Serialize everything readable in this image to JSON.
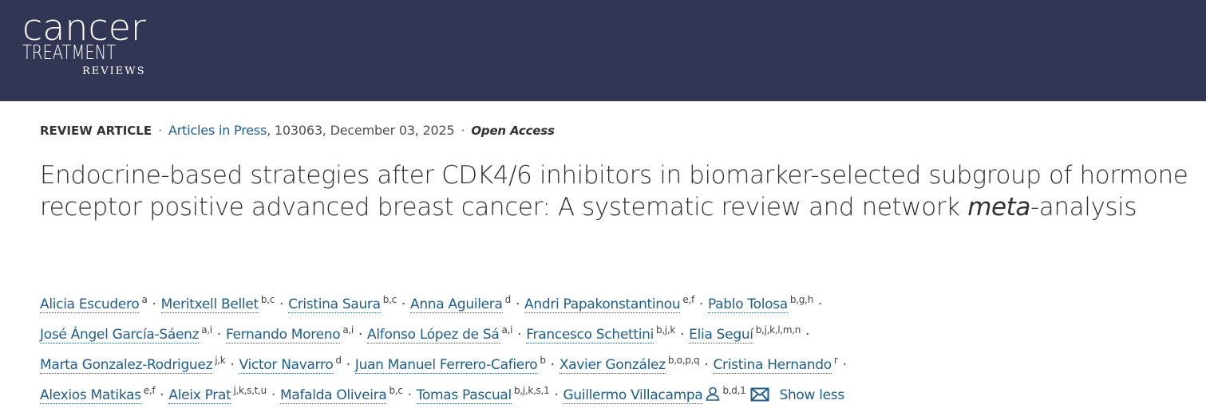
{
  "journal": {
    "logo_line1": "cancer",
    "logo_line2": "TREATMENT",
    "logo_line3": "REVIEWS"
  },
  "meta": {
    "article_type": "REVIEW ARTICLE",
    "section_link": "Articles in Press",
    "details": ", 103063, December 03, 2025",
    "access": "Open Access"
  },
  "title": {
    "part1": "Endocrine-based strategies after CDK4/6 inhibitors in biomarker-selected subgroup of hormone receptor positive advanced breast cancer: A systematic review and network ",
    "italic": "meta",
    "part2": "-analysis"
  },
  "authors": [
    [
      {
        "name": "Alicia Escudero",
        "aff": "a"
      },
      {
        "name": "Meritxell Bellet",
        "aff": "b,c"
      },
      {
        "name": "Cristina Saura",
        "aff": "b,c"
      },
      {
        "name": "Anna Aguilera",
        "aff": "d"
      },
      {
        "name": "Andri Papakonstantinou",
        "aff": "e,f"
      },
      {
        "name": "Pablo Tolosa",
        "aff": "b,g,h"
      }
    ],
    [
      {
        "name": "José Ángel García-Sáenz",
        "aff": "a,i"
      },
      {
        "name": "Fernando Moreno",
        "aff": "a,i"
      },
      {
        "name": "Alfonso López de Sá",
        "aff": "a,i"
      },
      {
        "name": "Francesco Schettini",
        "aff": "b,j,k"
      },
      {
        "name": "Elia Seguí",
        "aff": "b,j,k,l,m,n"
      }
    ],
    [
      {
        "name": "Marta Gonzalez-Rodriguez",
        "aff": "j,k"
      },
      {
        "name": "Victor Navarro",
        "aff": "d"
      },
      {
        "name": "Juan Manuel Ferrero-Cafiero",
        "aff": "b"
      },
      {
        "name": "Xavier González",
        "aff": "b,o,p,q"
      },
      {
        "name": "Cristina Hernando",
        "aff": "r"
      }
    ],
    [
      {
        "name": "Alexios Matikas",
        "aff": "e,f"
      },
      {
        "name": "Aleix Prat",
        "aff": "j,k,s,t,u"
      },
      {
        "name": "Mafalda Oliveira",
        "aff": "b,c"
      },
      {
        "name": "Tomas Pascual",
        "aff": "b,j,k,s,1"
      },
      {
        "name": "Guillermo Villacampa",
        "aff": "b,d,1"
      }
    ]
  ],
  "separator": "·",
  "show_less_label": "Show less",
  "colors": {
    "header_bg": "#323655",
    "link": "#1f5d8c"
  }
}
